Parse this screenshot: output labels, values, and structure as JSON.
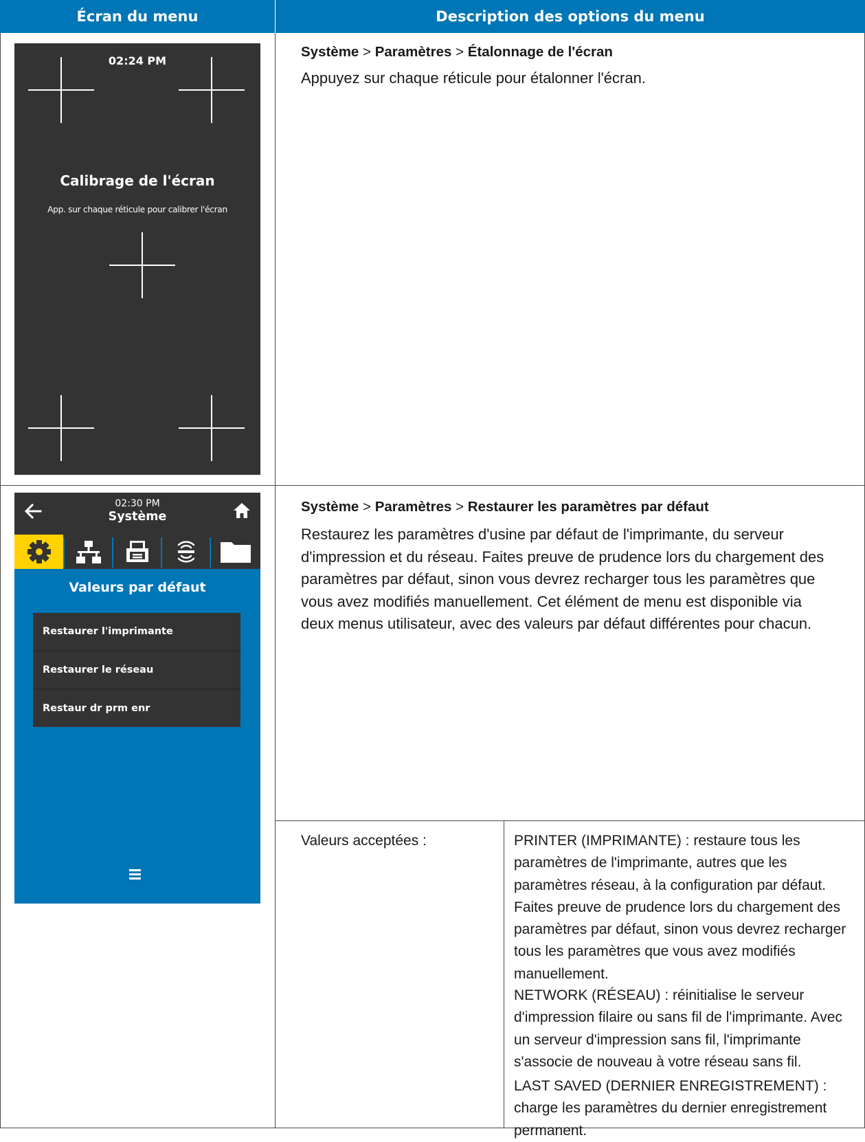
{
  "table": {
    "header_left": "Écran du menu",
    "header_right": "Description des options du menu"
  },
  "row1": {
    "breadcrumb": {
      "a": "Système",
      "sep1": " > ",
      "b": "Paramètres",
      "sep2": " > ",
      "c": "Étalonnage de l'écran"
    },
    "description": "Appuyez sur chaque réticule pour étalonner l'écran.",
    "screen": {
      "time": "02:24 PM",
      "title": "Calibrage de l'écran",
      "subtitle": "App. sur chaque réticule pour calibrer l'écran",
      "icons": [
        "crosshair-icon"
      ]
    }
  },
  "row2": {
    "breadcrumb": {
      "a": "Système",
      "sep1": " > ",
      "b": "Paramètres",
      "sep2": " > ",
      "c": "Restaurer les paramètres par défaut"
    },
    "description": "Restaurez les paramètres d'usine par défaut de l'imprimante, du serveur d'impression et du réseau. Faites preuve de prudence lors du chargement des paramètres par défaut, sinon vous devrez recharger tous les paramètres que vous avez modifiés manuellement. Cet élément de menu est disponible via deux menus utilisateur, avec des valeurs par défaut différentes pour chacun.",
    "accepted_label": "Valeurs acceptées :",
    "options": [
      "PRINTER (IMPRIMANTE) : restaure tous les paramètres de l'imprimante, autres que les paramètres réseau, à la configuration par défaut. Faites preuve de prudence lors du chargement des paramètres par défaut, sinon vous devrez recharger tous les paramètres que vous avez modifiés manuellement.",
      "NETWORK (RÉSEAU) : réinitialise le serveur d'impression filaire ou sans fil de l'imprimante. Avec un serveur d'impression sans fil, l'imprimante s'associe de nouveau à votre réseau sans fil.",
      "LAST SAVED (DERNIER ENREGISTREMENT) : charge les paramètres du dernier enregistrement permanent."
    ],
    "screen": {
      "time": "02:30 PM",
      "title": "Système",
      "heading": "Valeurs par défaut",
      "menu_items": [
        "Restaurer l'imprimante",
        "Restaurer le réseau",
        "Restaur dr prm enr"
      ],
      "tabs": [
        "gear-icon",
        "network-icon",
        "printer-icon",
        "wireless-icon",
        "folder-icon"
      ],
      "colors": {
        "accent": "#0076b6",
        "active_tab": "#ffd200",
        "panel": "#333333"
      }
    }
  }
}
